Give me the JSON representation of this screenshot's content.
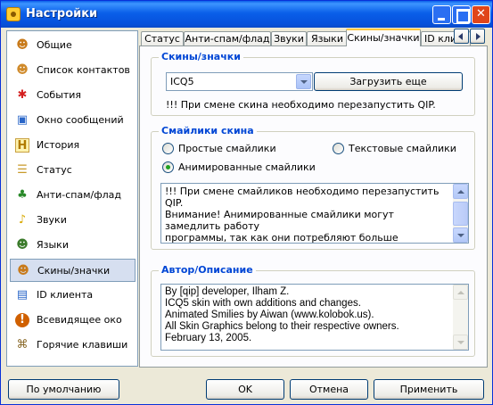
{
  "window": {
    "title": "Настройки"
  },
  "sidebar": {
    "items": [
      {
        "label": "Общие",
        "icon": "user-icon",
        "glyph": "☻",
        "color": "#c87a1a"
      },
      {
        "label": "Список контактов",
        "icon": "contacts-icon",
        "glyph": "☻",
        "color": "#d08a2a"
      },
      {
        "label": "События",
        "icon": "events-icon",
        "glyph": "✱",
        "color": "#d42020"
      },
      {
        "label": "Окно сообщений",
        "icon": "message-window-icon",
        "glyph": "▣",
        "color": "#2a66c8"
      },
      {
        "label": "История",
        "icon": "history-icon",
        "glyph": "H",
        "color": "#b07a00"
      },
      {
        "label": "Статус",
        "icon": "status-icon",
        "glyph": "☰",
        "color": "#c89a2a"
      },
      {
        "label": "Анти-спам/флад",
        "icon": "antispam-icon",
        "glyph": "♣",
        "color": "#2a8a2a"
      },
      {
        "label": "Звуки",
        "icon": "sounds-icon",
        "glyph": "♪",
        "color": "#d8a800"
      },
      {
        "label": "Языки",
        "icon": "languages-icon",
        "glyph": "☻",
        "color": "#3a7a2a"
      },
      {
        "label": "Скины/значки",
        "icon": "skins-icon",
        "glyph": "☻",
        "color": "#c87a1a"
      },
      {
        "label": "ID клиента",
        "icon": "client-id-icon",
        "glyph": "▤",
        "color": "#2a66c8"
      },
      {
        "label": "Всевидящее око",
        "icon": "all-seeing-eye-icon",
        "glyph": "!",
        "color": "#d06000"
      },
      {
        "label": "Горячие клавиши",
        "icon": "hotkeys-icon",
        "glyph": "⌘",
        "color": "#8a6a2a"
      }
    ],
    "selected_index": 9
  },
  "tabs": [
    {
      "label": "Статус"
    },
    {
      "label": "Анти-спам/флад"
    },
    {
      "label": "Звуки"
    },
    {
      "label": "Языки"
    },
    {
      "label": "Скины/значки"
    },
    {
      "label": "ID клие"
    }
  ],
  "active_tab": "Скины/значки",
  "skins_group": {
    "title": "Скины/значки",
    "skin_select": {
      "value": "ICQ5"
    },
    "load_more_label": "Загрузить еще",
    "note": "!!! При смене скина необходимо перезапустить QIP."
  },
  "smileys_group": {
    "title": "Смайлики скина",
    "options": [
      {
        "label": "Простые смайлики",
        "checked": false
      },
      {
        "label": "Текстовые смайлики",
        "checked": false
      },
      {
        "label": "Анимированные смайлики",
        "checked": true
      }
    ],
    "info_text": "!!! При смене смайликов необходимо перезапустить QIP.\nВнимание! Анимированные смайлики могут замедлить работу\nпрограммы, так как они потребляют больше системных\nресурсов. Время от времени эти смайлики будут заменяться\nтекстом в окне сообщений для высвобождения ресурсов"
  },
  "author_group": {
    "title": "Автор/Описание",
    "text": "By [qip] developer, Ilham Z.\nICQ5 skin with own additions and changes.\nAnimated Smilies by Aiwan (www.kolobok.us).\nAll Skin Graphics belong to their respective owners.\nFebruary 13, 2005."
  },
  "footer": {
    "defaults_label": "По умолчанию",
    "ok_label": "OK",
    "cancel_label": "Отмена",
    "apply_label": "Применить"
  }
}
